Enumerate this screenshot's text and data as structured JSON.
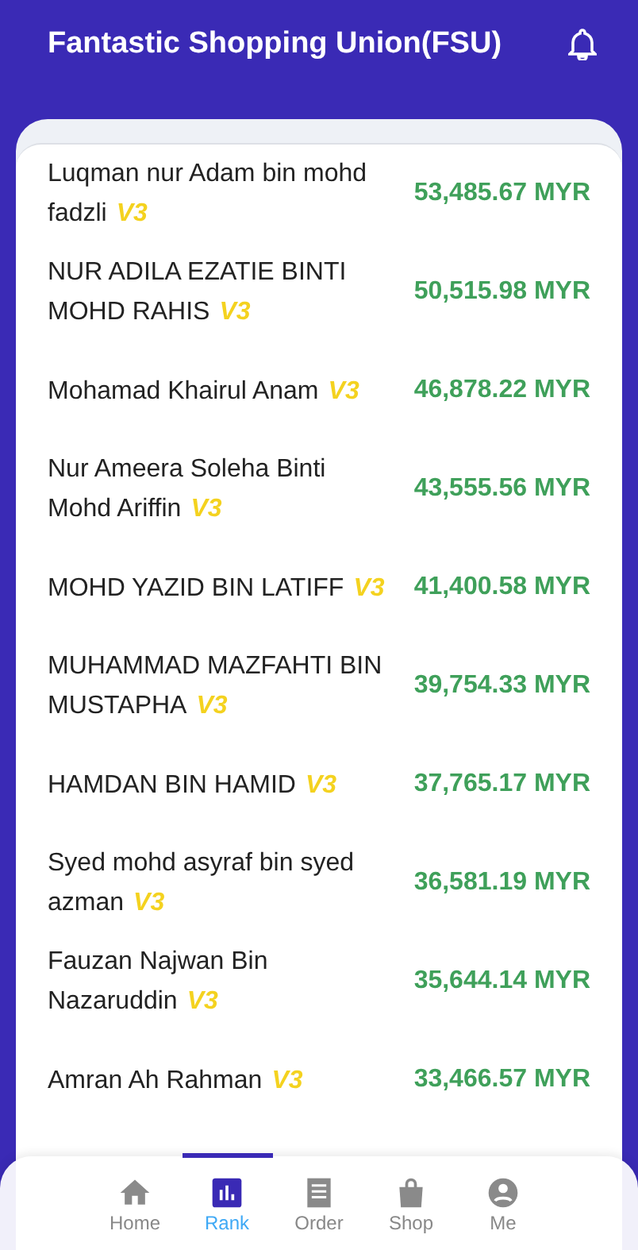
{
  "header": {
    "title": "Fantastic Shopping Union(FSU)"
  },
  "ranking": [
    {
      "name": "Luqman nur Adam bin mohd fadzli",
      "badge": "V3",
      "amount": "53,485.67 MYR"
    },
    {
      "name": "NUR ADILA EZATIE BINTI MOHD RAHIS",
      "badge": "V3",
      "amount": "50,515.98 MYR"
    },
    {
      "name": "Mohamad Khairul Anam",
      "badge": "V3",
      "amount": "46,878.22 MYR"
    },
    {
      "name": "Nur Ameera Soleha Binti Mohd Ariffin",
      "badge": "V3",
      "amount": "43,555.56 MYR"
    },
    {
      "name": "MOHD YAZID BIN LATIFF",
      "badge": "V3",
      "amount": "41,400.58 MYR"
    },
    {
      "name": "MUHAMMAD MAZFAHTI BIN MUSTAPHA",
      "badge": "V3",
      "amount": "39,754.33 MYR"
    },
    {
      "name": "HAMDAN BIN HAMID",
      "badge": "V3",
      "amount": "37,765.17 MYR"
    },
    {
      "name": "Syed mohd asyraf bin syed azman",
      "badge": "V3",
      "amount": "36,581.19 MYR"
    },
    {
      "name": "Fauzan Najwan Bin Nazaruddin",
      "badge": "V3",
      "amount": "35,644.14 MYR"
    },
    {
      "name": "Amran Ah Rahman",
      "badge": "V3",
      "amount": "33,466.57 MYR"
    }
  ],
  "nav": [
    {
      "kind": "home",
      "label": "Home",
      "selected": false
    },
    {
      "kind": "rank",
      "label": "Rank",
      "selected": true
    },
    {
      "kind": "order",
      "label": "Order",
      "selected": false
    },
    {
      "kind": "shop",
      "label": "Shop",
      "selected": false
    },
    {
      "kind": "me",
      "label": "Me",
      "selected": false
    }
  ]
}
